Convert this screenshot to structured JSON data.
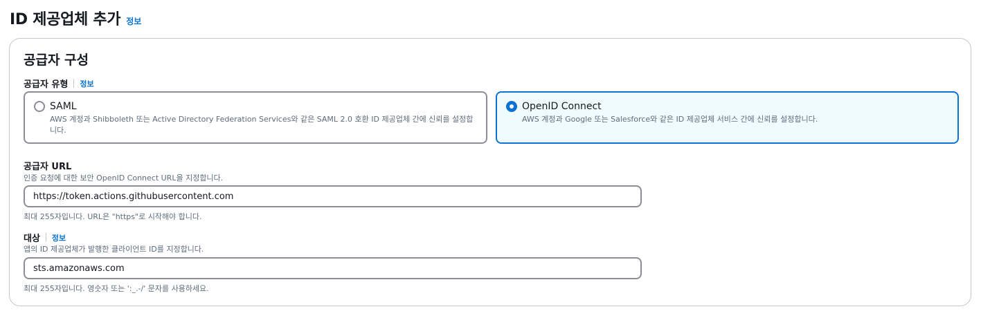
{
  "header": {
    "title": "ID 제공업체 추가",
    "info_label": "정보"
  },
  "provider_config": {
    "title": "공급자 구성",
    "type_label": "공급자 유형",
    "type_info": "정보",
    "options": [
      {
        "title": "SAML",
        "description": "AWS 계정과 Shibboleth 또는 Active Directory Federation Services와 같은 SAML 2.0 호환 ID 제공업체 간에 신뢰를 설정합니다.",
        "selected": false
      },
      {
        "title": "OpenID Connect",
        "description": "AWS 계정과 Google 또는 Salesforce와 같은 ID 제공업체 서비스 간에 신뢰를 설정합니다.",
        "selected": true
      }
    ],
    "url": {
      "label": "공급자 URL",
      "description": "인증 요청에 대한 보안 OpenID Connect URL을 지정합니다.",
      "value": "https://token.actions.githubusercontent.com",
      "constraint": "최대 255자입니다. URL은 \"https\"로 시작해야 합니다."
    },
    "audience": {
      "label": "대상",
      "info": "정보",
      "description": "앱의 ID 제공업체가 발행한 클라이언트 ID를 지정합니다.",
      "value": "sts.amazonaws.com",
      "constraint": "최대 255자입니다. 영숫자 또는 ':_.-/' 문자를 사용하세요."
    }
  },
  "colors": {
    "accent": "#0972d3",
    "selected_bg": "#f0fbff",
    "border": "#8c8c94",
    "muted_text": "#5f6b7a"
  }
}
